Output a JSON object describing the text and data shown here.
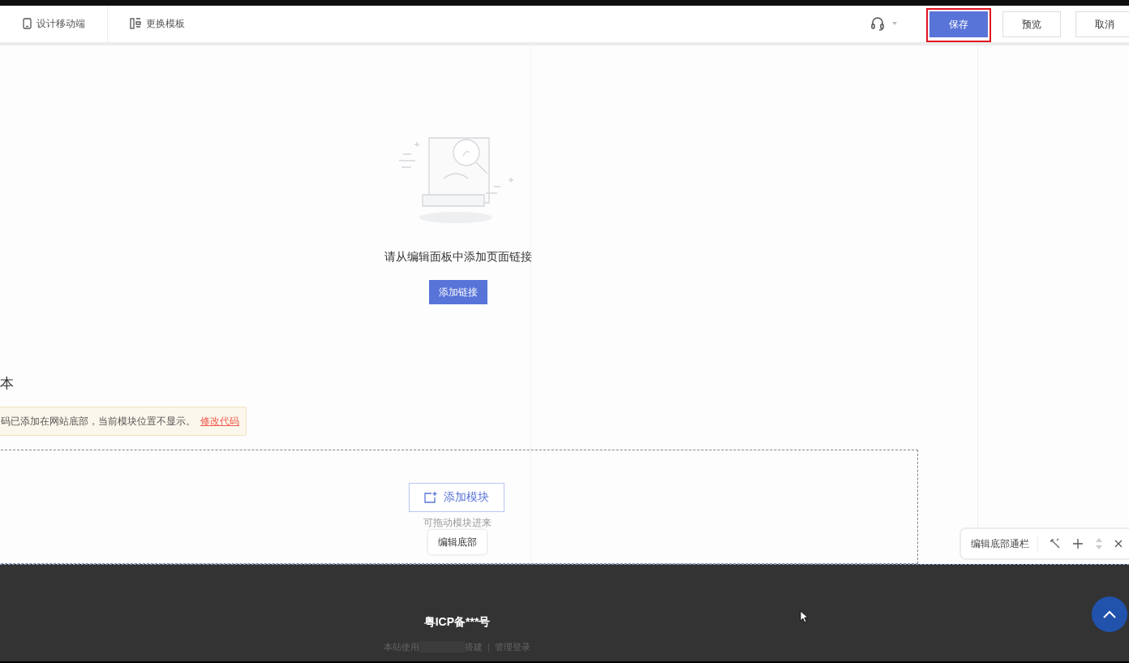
{
  "top_bar": {
    "left_tools": [
      {
        "kind": "mobile",
        "label": "设计移动端"
      },
      {
        "kind": "template",
        "label": "更换模板"
      }
    ],
    "buttons": [
      {
        "label": "保存",
        "primary": true,
        "highlighted": true
      },
      {
        "label": "预览",
        "primary": false,
        "highlighted": false
      },
      {
        "label": "取消",
        "primary": false,
        "highlighted": false
      }
    ]
  },
  "empty_state": {
    "message": "请从编辑面板中添加页面链接",
    "button": "添加链接"
  },
  "section": {
    "title_fragment": "本",
    "notice": "码已添加在网站底部，当前模块位置不显示。",
    "notice_link": "修改代码"
  },
  "module_area": {
    "add_button": "添加模块",
    "hint": "可拖动模块进来",
    "edit_tab": "编辑底部"
  },
  "footer_toolbar": {
    "label": "编辑底部通栏"
  },
  "footer": {
    "icp": "粤ICP备***号",
    "powered_prefix": "本站使用",
    "powered_suffix": "搭建",
    "separator": "|",
    "admin_link": "管理登录"
  }
}
